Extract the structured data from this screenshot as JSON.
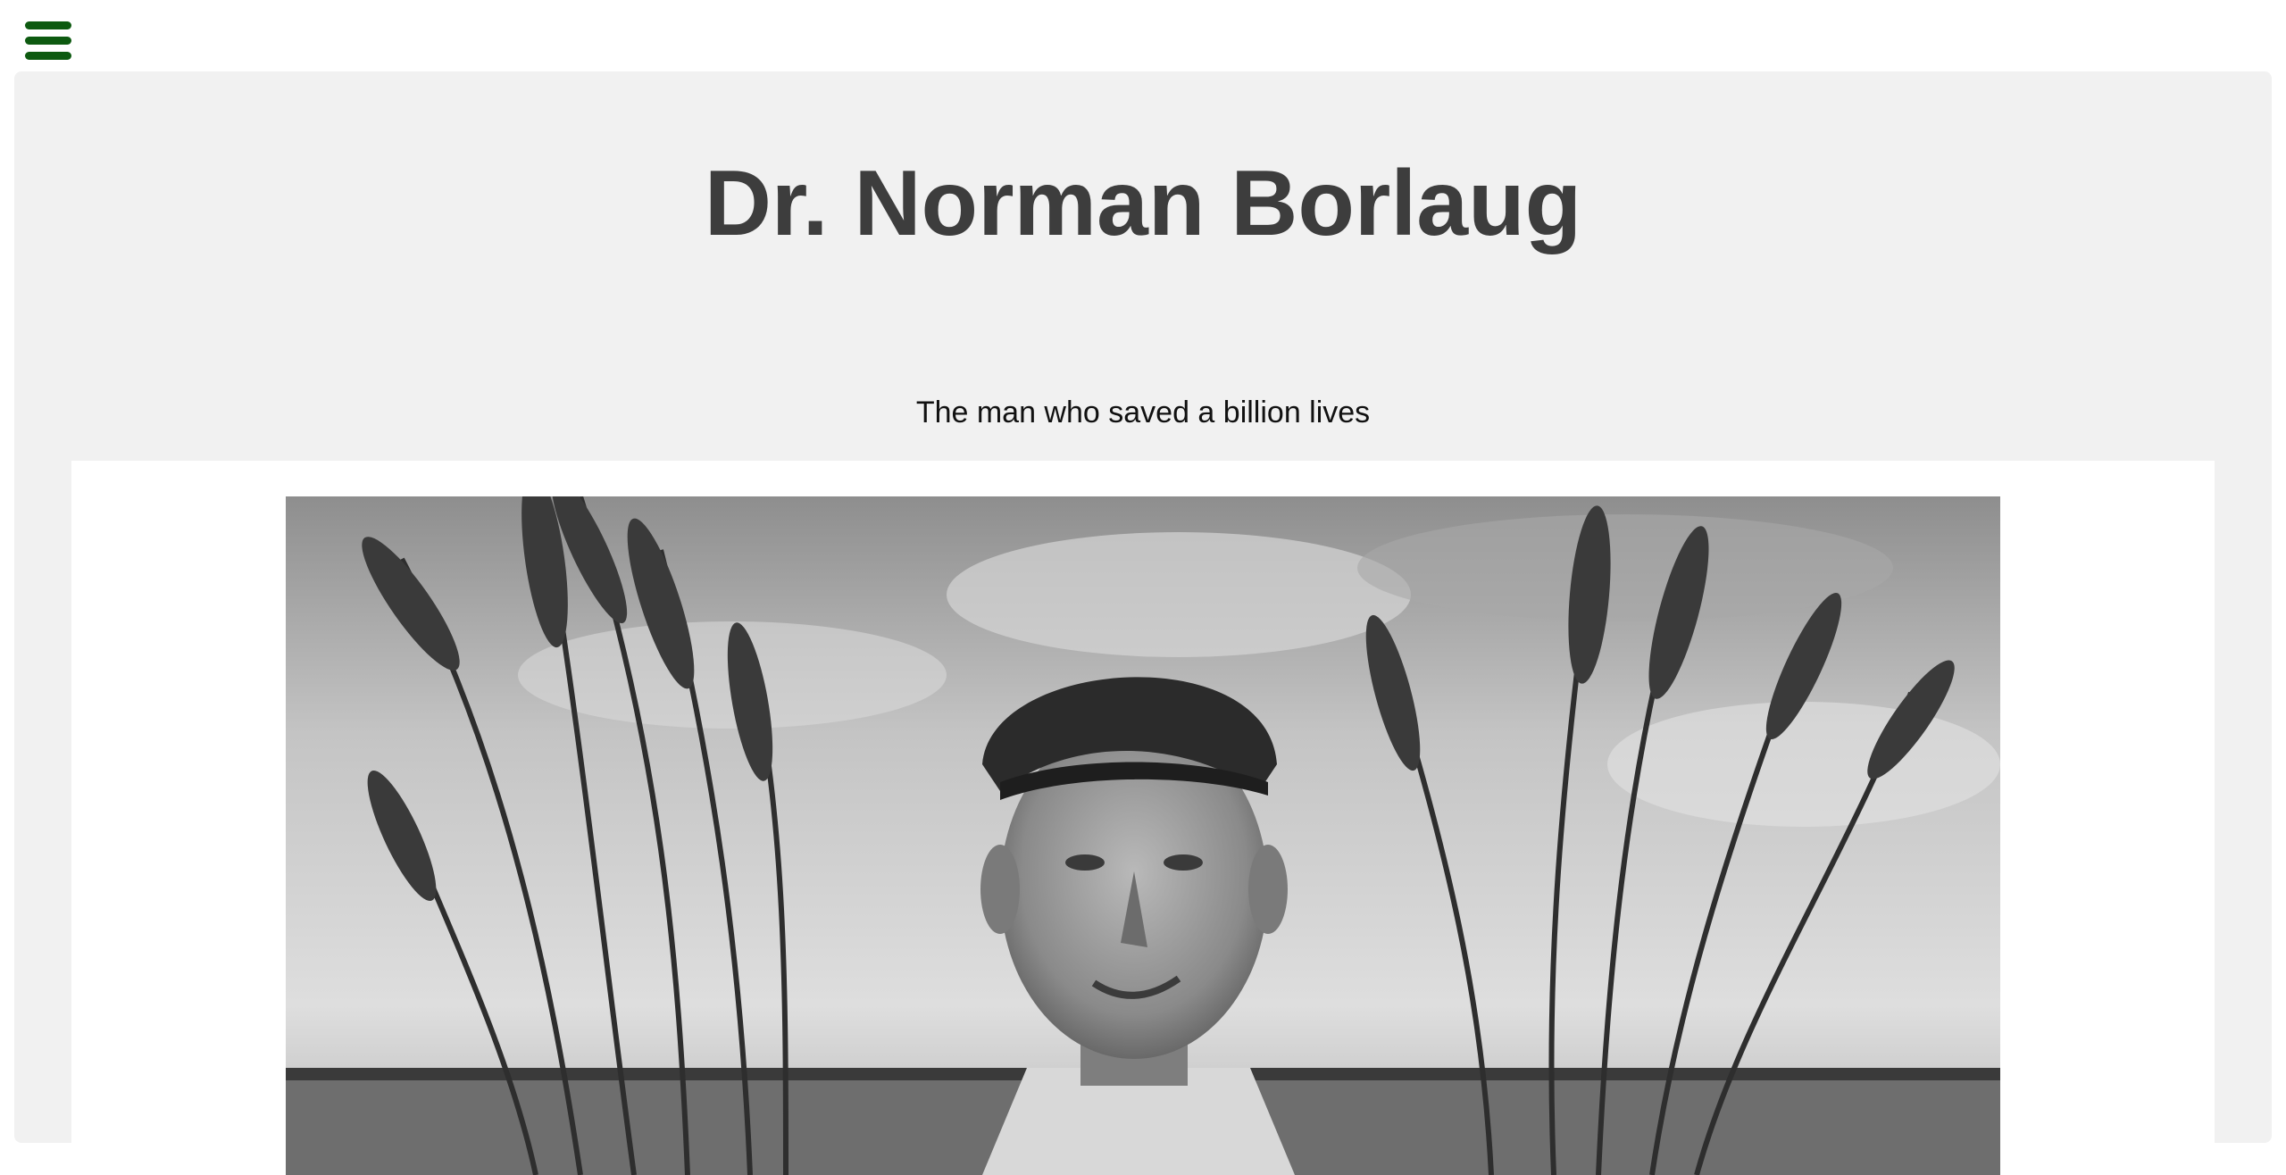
{
  "nav": {
    "menu_icon": "hamburger-menu-icon",
    "menu_color": "#0d5a10"
  },
  "header": {
    "title": "Dr. Norman Borlaug",
    "subtitle": "The man who saved a billion lives"
  },
  "hero_image": {
    "style": "black-and-white photograph",
    "subject": "man in a cap holding wheat stalks in a field"
  },
  "colors": {
    "panel_background": "#f1f1f1",
    "title_color": "#3d3d3d",
    "card_background": "#ffffff"
  }
}
